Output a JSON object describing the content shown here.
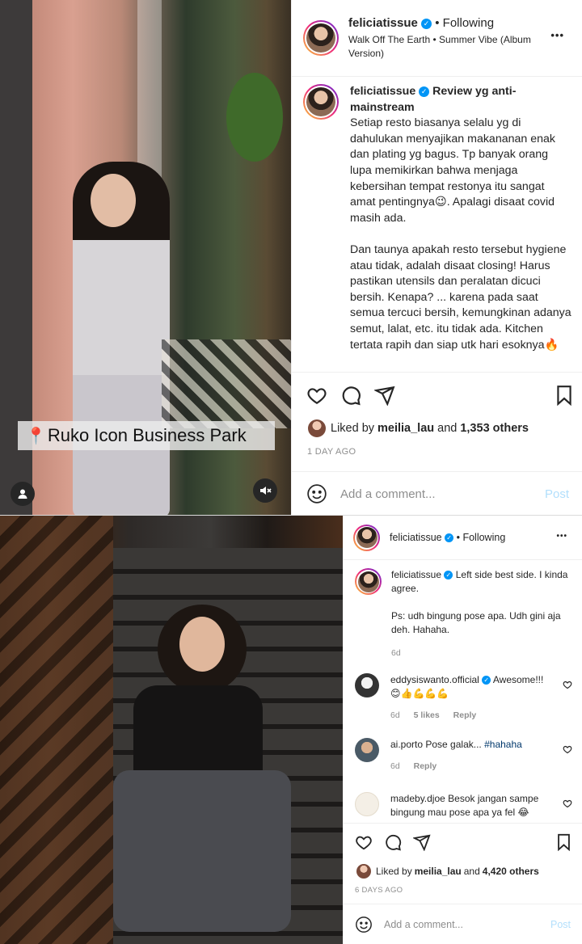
{
  "post1": {
    "location_tag": "Ruko Icon Business Park",
    "header": {
      "username": "feliciatissue",
      "separator": "•",
      "following": "Following",
      "audio": "Walk Off The Earth • Summer Vibe (Album Version)",
      "more": "•••"
    },
    "caption": {
      "username": "feliciatissue",
      "title": "Review yg anti-mainstream",
      "text": "Setiap resto biasanya selalu yg di dahulukan menyajikan makananan enak dan plating yg bagus. Tp banyak orang lupa memikirkan bahwa menjaga kebersihan tempat restonya itu sangat amat pentingnya😉. Apalagi disaat covid masih ada.\n\nDan taunya apakah resto tersebut hygiene atau tidak, adalah disaat closing! Harus pastikan utensils dan peralatan dicuci bersih. Kenapa? ... karena pada saat semua tercuci bersih, kemungkinan adanya semut, lalat, etc. itu tidak ada. Kitchen tertata rapih dan siap utk hari esoknya🔥"
    },
    "likes": {
      "prefix": "Liked by",
      "user": "meilia_lau",
      "and": "and",
      "count": "1,353 others"
    },
    "date": "1 DAY AGO",
    "add_comment": {
      "placeholder": "Add a comment...",
      "post_label": "Post"
    }
  },
  "post2": {
    "header": {
      "username": "feliciatissue",
      "separator": "•",
      "following": "Following",
      "more": "•••"
    },
    "caption": {
      "username": "feliciatissue",
      "text": "Left side best side. I kinda agree.\n\nPs: udh bingung pose apa. Udh gini aja deh. Hahaha.",
      "age": "6d"
    },
    "comments": [
      {
        "username": "eddysiswanto.official",
        "verified": true,
        "text": "Awesome!!!",
        "emoji": "😊👍💪💪💪",
        "age": "6d",
        "likes": "5 likes",
        "reply": "Reply"
      },
      {
        "username": "ai.porto",
        "verified": false,
        "text": "Pose galak... ",
        "hashtag": "#hahaha",
        "age": "6d",
        "reply": "Reply"
      },
      {
        "username": "madeby.djoe",
        "verified": false,
        "text": "Besok jangan sampe bingung mau pose apa ya fel 😂",
        "age": "",
        "reply": ""
      }
    ],
    "likes": {
      "prefix": "Liked by",
      "user": "meilia_lau",
      "and": "and",
      "count": "4,420 others"
    },
    "date": "6 DAYS AGO",
    "add_comment": {
      "placeholder": "Add a comment...",
      "post_label": "Post"
    }
  }
}
